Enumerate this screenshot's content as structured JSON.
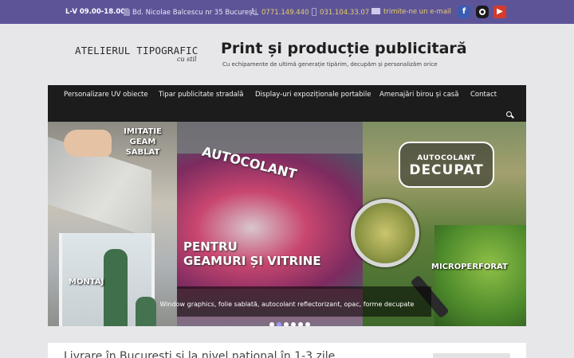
{
  "topbar": {
    "hours": "L-V 09.00-18.00",
    "address": "Bd. Nicolae Balcescu nr 35 București",
    "phone1": "0771.149.440",
    "phone2": "031.104.33.07",
    "email_link": "trimite-ne un e-mail",
    "social": {
      "facebook_icon": "facebook-icon",
      "instagram_icon": "instagram-icon",
      "youtube_icon": "youtube-icon"
    }
  },
  "header": {
    "logo_main": "ATELIERUL TIPOGRAFIC",
    "logo_sub": "cu stil",
    "title": "Print și producție publicitară",
    "tagline": "Cu echipamente de ultimă generație tipărim, decupăm și personalizăm orice"
  },
  "nav": {
    "items": [
      "Personalizare UV obiecte",
      "Tipar publicitate stradală",
      "Display-uri expoziționale portabile",
      "Amenajări birou și casă",
      "Contact"
    ],
    "search_icon": "search-icon"
  },
  "slider": {
    "left_label": "IMITAȚIE GEAM SABLAT",
    "left_bottom_label": "MONTAJ",
    "mid_top": "AUTOCOLANT",
    "mid_bottom_line1": "PENTRU",
    "mid_bottom_line2": "GEAMURI ȘI VITRINE",
    "right_badge_top": "AUTOCOLANT",
    "right_badge_main": "DECUPAT",
    "right_label": "MICROPERFORAT",
    "caption": "Window graphics, folie sablată, autocolant reflectorizant, opac, forme decupate",
    "slide_count": 6,
    "active_slide": 2
  },
  "content": {
    "heading": "Livrare în București și la nivel național în 1-3 zile"
  },
  "colors": {
    "topbar_bg": "#5d5498",
    "topbar_accent": "#e6cf6a",
    "nav_bg": "#1c1c1c",
    "page_bg": "#e7e7e9"
  }
}
